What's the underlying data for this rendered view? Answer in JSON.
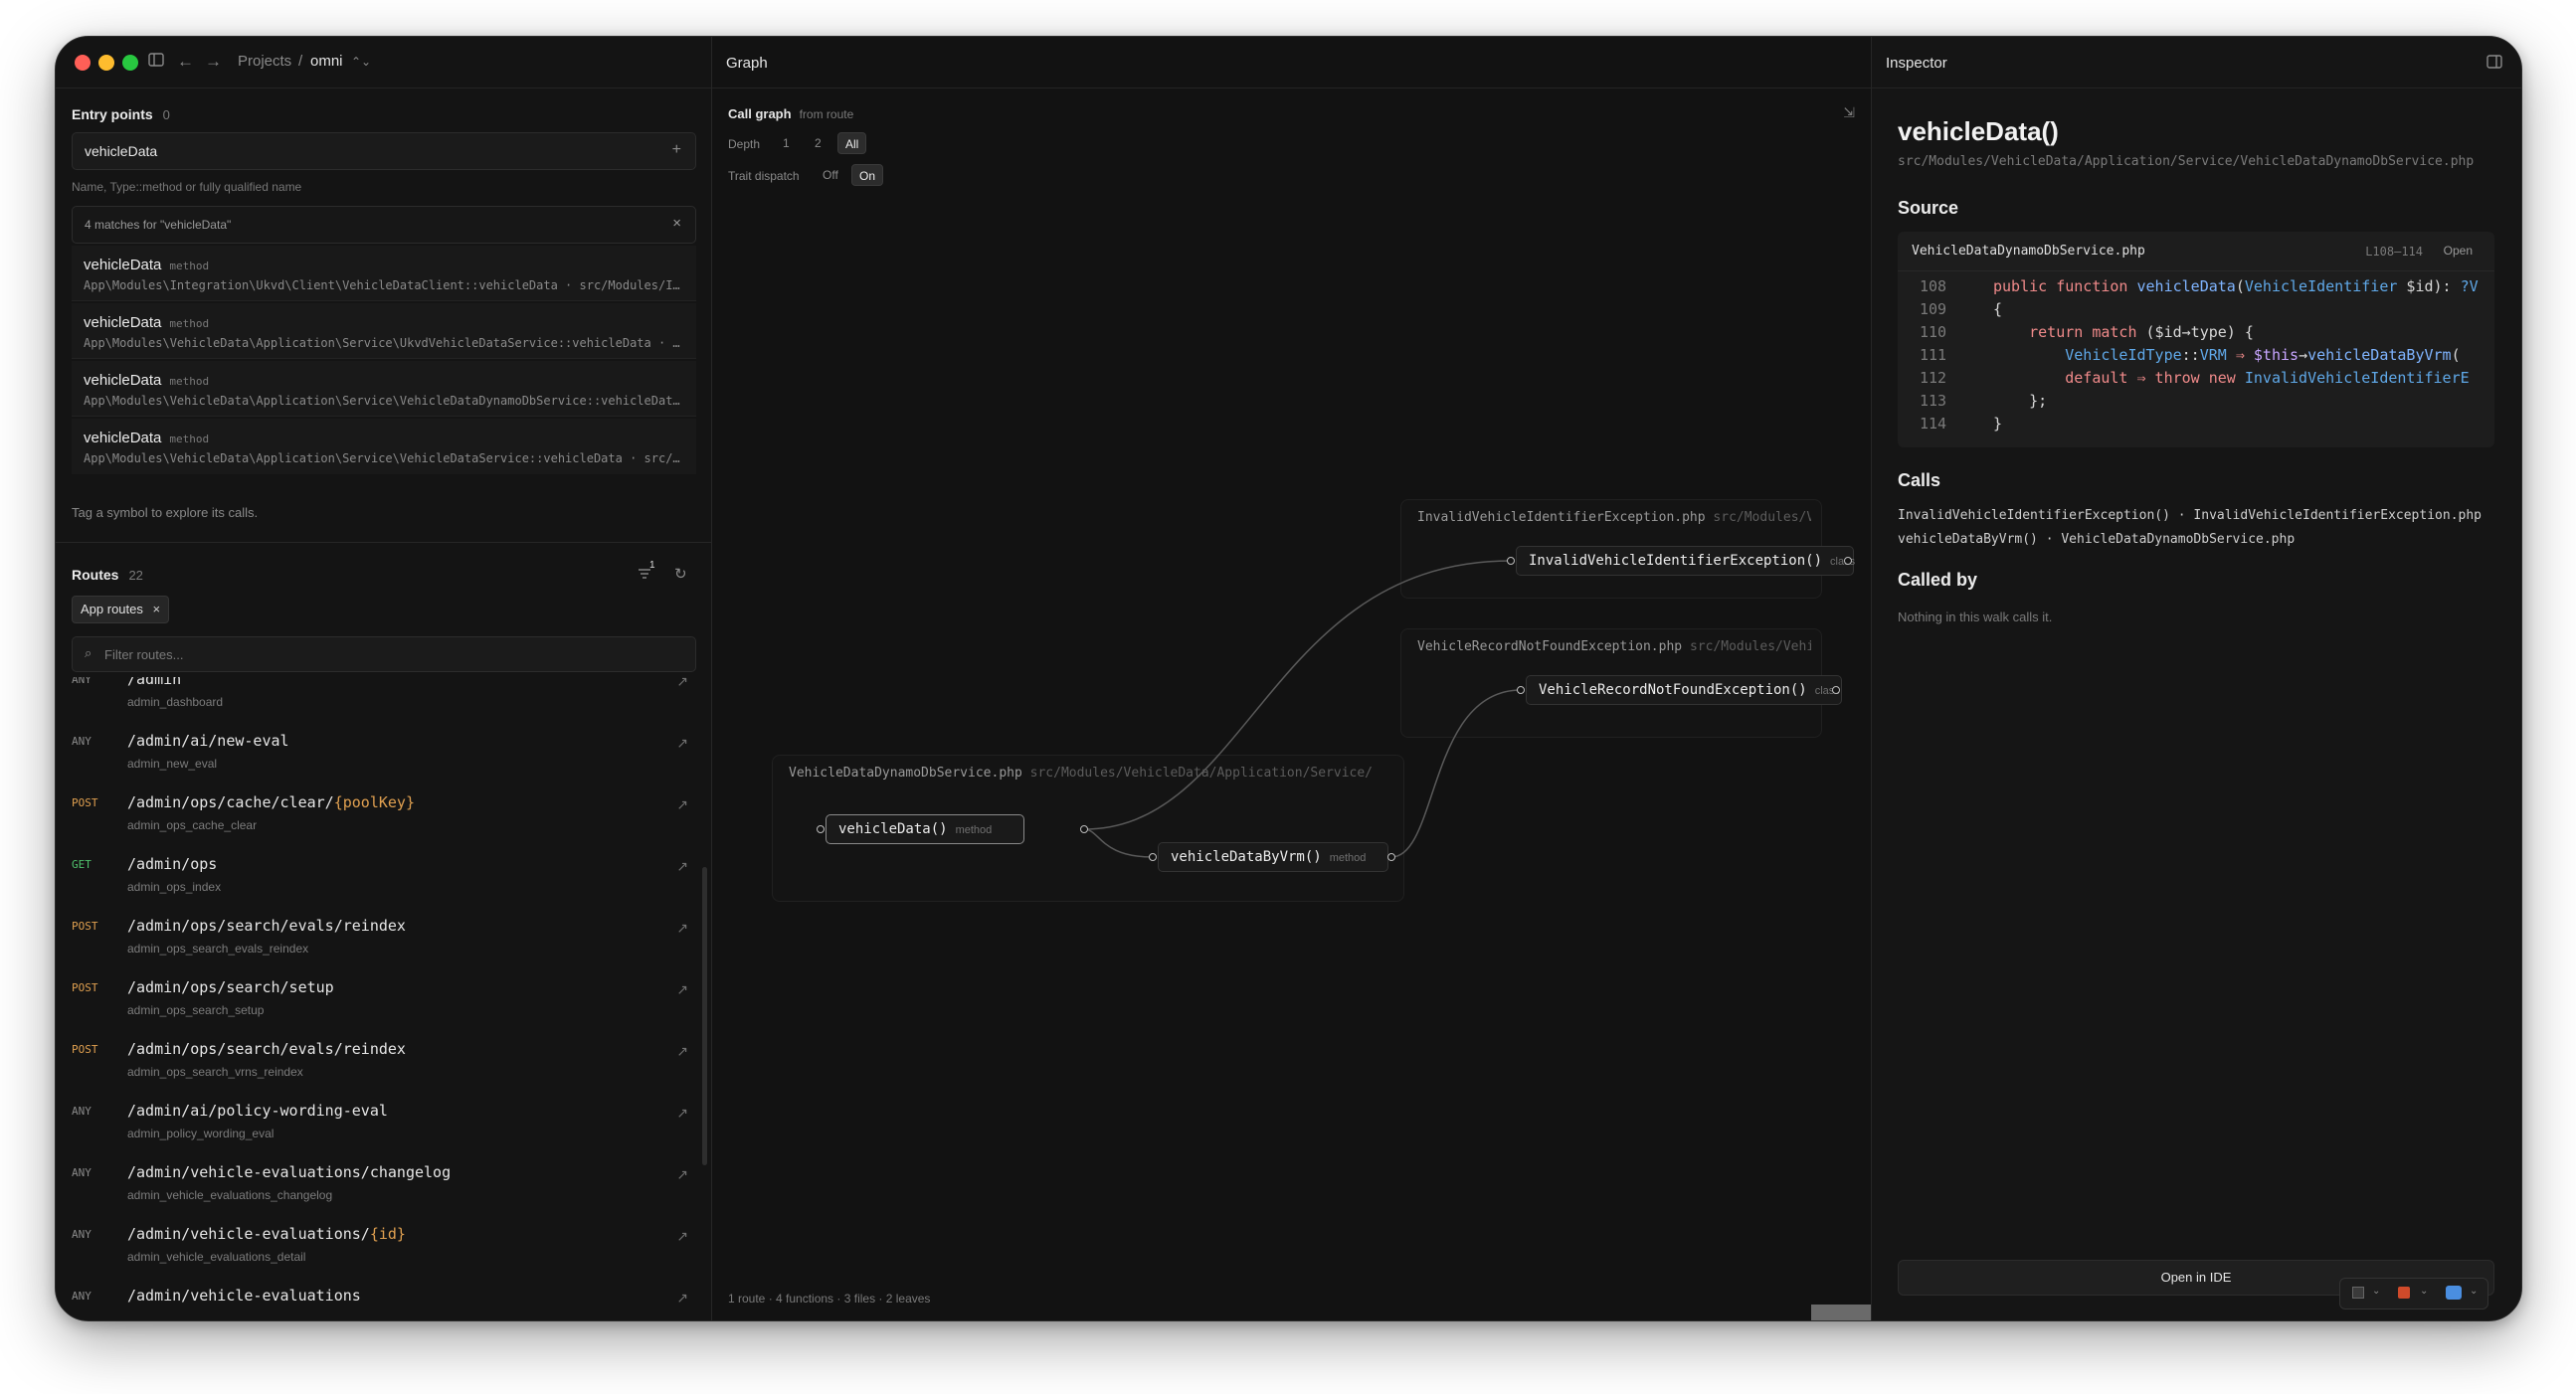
{
  "window": {
    "breadcrumb": [
      "Projects",
      "/",
      "omni"
    ],
    "center_title": "Graph",
    "right_title": "Inspector"
  },
  "entry_points": {
    "title": "Entry points",
    "count": "0",
    "input_value": "vehicleData",
    "hint": "Name, Type::method or fully qualified name",
    "matches_label": "4 matches for \"vehicleData\"",
    "matches": [
      {
        "name": "vehicleData",
        "kind": "method",
        "path": "App\\Modules\\Integration\\Ukvd\\Client\\VehicleDataClient::vehicleData · src/Modules/In…"
      },
      {
        "name": "vehicleData",
        "kind": "method",
        "path": "App\\Modules\\VehicleData\\Application\\Service\\UkvdVehicleDataService::vehicleData · s…"
      },
      {
        "name": "vehicleData",
        "kind": "method",
        "path": "App\\Modules\\VehicleData\\Application\\Service\\VehicleDataDynamoDbService::vehicleData…"
      },
      {
        "name": "vehicleData",
        "kind": "method",
        "path": "App\\Modules\\VehicleData\\Application\\Service\\VehicleDataService::vehicleData · src/M…"
      }
    ],
    "tag_hint": "Tag a symbol to explore its calls."
  },
  "routes": {
    "title": "Routes",
    "count": "22",
    "filter_badge": "1",
    "chip": "App routes",
    "filter_placeholder": "Filter routes...",
    "items": [
      {
        "method": "ANY",
        "path": "/admin",
        "param": "",
        "name": "admin_dashboard"
      },
      {
        "method": "ANY",
        "path": "/admin/ai/new-eval",
        "param": "",
        "name": "admin_new_eval"
      },
      {
        "method": "POST",
        "path": "/admin/ops/cache/clear/",
        "param": "{poolKey}",
        "name": "admin_ops_cache_clear"
      },
      {
        "method": "GET",
        "path": "/admin/ops",
        "param": "",
        "name": "admin_ops_index"
      },
      {
        "method": "POST",
        "path": "/admin/ops/search/evals/reindex",
        "param": "",
        "name": "admin_ops_search_evals_reindex"
      },
      {
        "method": "POST",
        "path": "/admin/ops/search/setup",
        "param": "",
        "name": "admin_ops_search_setup"
      },
      {
        "method": "POST",
        "path": "/admin/ops/search/evals/reindex",
        "param": "",
        "name": "admin_ops_search_vrns_reindex"
      },
      {
        "method": "ANY",
        "path": "/admin/ai/policy-wording-eval",
        "param": "",
        "name": "admin_policy_wording_eval"
      },
      {
        "method": "ANY",
        "path": "/admin/vehicle-evaluations/changelog",
        "param": "",
        "name": "admin_vehicle_evaluations_changelog"
      },
      {
        "method": "ANY",
        "path": "/admin/vehicle-evaluations/",
        "param": "{id}",
        "name": "admin_vehicle_evaluations_detail"
      },
      {
        "method": "ANY",
        "path": "/admin/vehicle-evaluations",
        "param": "",
        "name": ""
      }
    ]
  },
  "graph": {
    "title": "Call graph",
    "subtitle": "from route",
    "depth_label": "Depth",
    "depth_options": [
      "1",
      "2",
      "All"
    ],
    "trait_label": "Trait dispatch",
    "trait_options": [
      "Off",
      "On"
    ],
    "groups": [
      {
        "file": "InvalidVehicleIdentifierException.php",
        "dir": "src/Modules/Veh…"
      },
      {
        "file": "VehicleRecordNotFoundException.php",
        "dir": "src/Modules/Vehicl…"
      },
      {
        "file": "VehicleDataDynamoDbService.php",
        "dir": "src/Modules/VehicleData/Application/Service/"
      }
    ],
    "nodes": [
      {
        "label": "InvalidVehicleIdentifierException()",
        "kind": "class"
      },
      {
        "label": "VehicleRecordNotFoundException()",
        "kind": "class"
      },
      {
        "label": "vehicleData()",
        "kind": "method"
      },
      {
        "label": "vehicleDataByVrm()",
        "kind": "method"
      }
    ],
    "footer": "1 route · 4 functions · 3 files · 2 leaves"
  },
  "inspector": {
    "symbol": "vehicleData()",
    "path": "src/Modules/VehicleData/Application/Service/VehicleDataDynamoDbService.php",
    "source_title": "Source",
    "source_file": "VehicleDataDynamoDbService.php",
    "source_range": "L108–114",
    "source_open": "Open",
    "code_lines": [
      "108",
      "109",
      "110",
      "111",
      "112",
      "113",
      "114"
    ],
    "calls_title": "Calls",
    "calls": [
      "InvalidVehicleIdentifierException() · InvalidVehicleIdentifierException.php",
      "vehicleDataByVrm() · VehicleDataDynamoDbService.php"
    ],
    "called_by_title": "Called by",
    "called_by_empty": "Nothing in this walk calls it.",
    "open_ide": "Open in IDE"
  },
  "colors": {
    "accent_post": "#e0a050",
    "accent_get": "#4fc16c",
    "bg": "#161616"
  }
}
